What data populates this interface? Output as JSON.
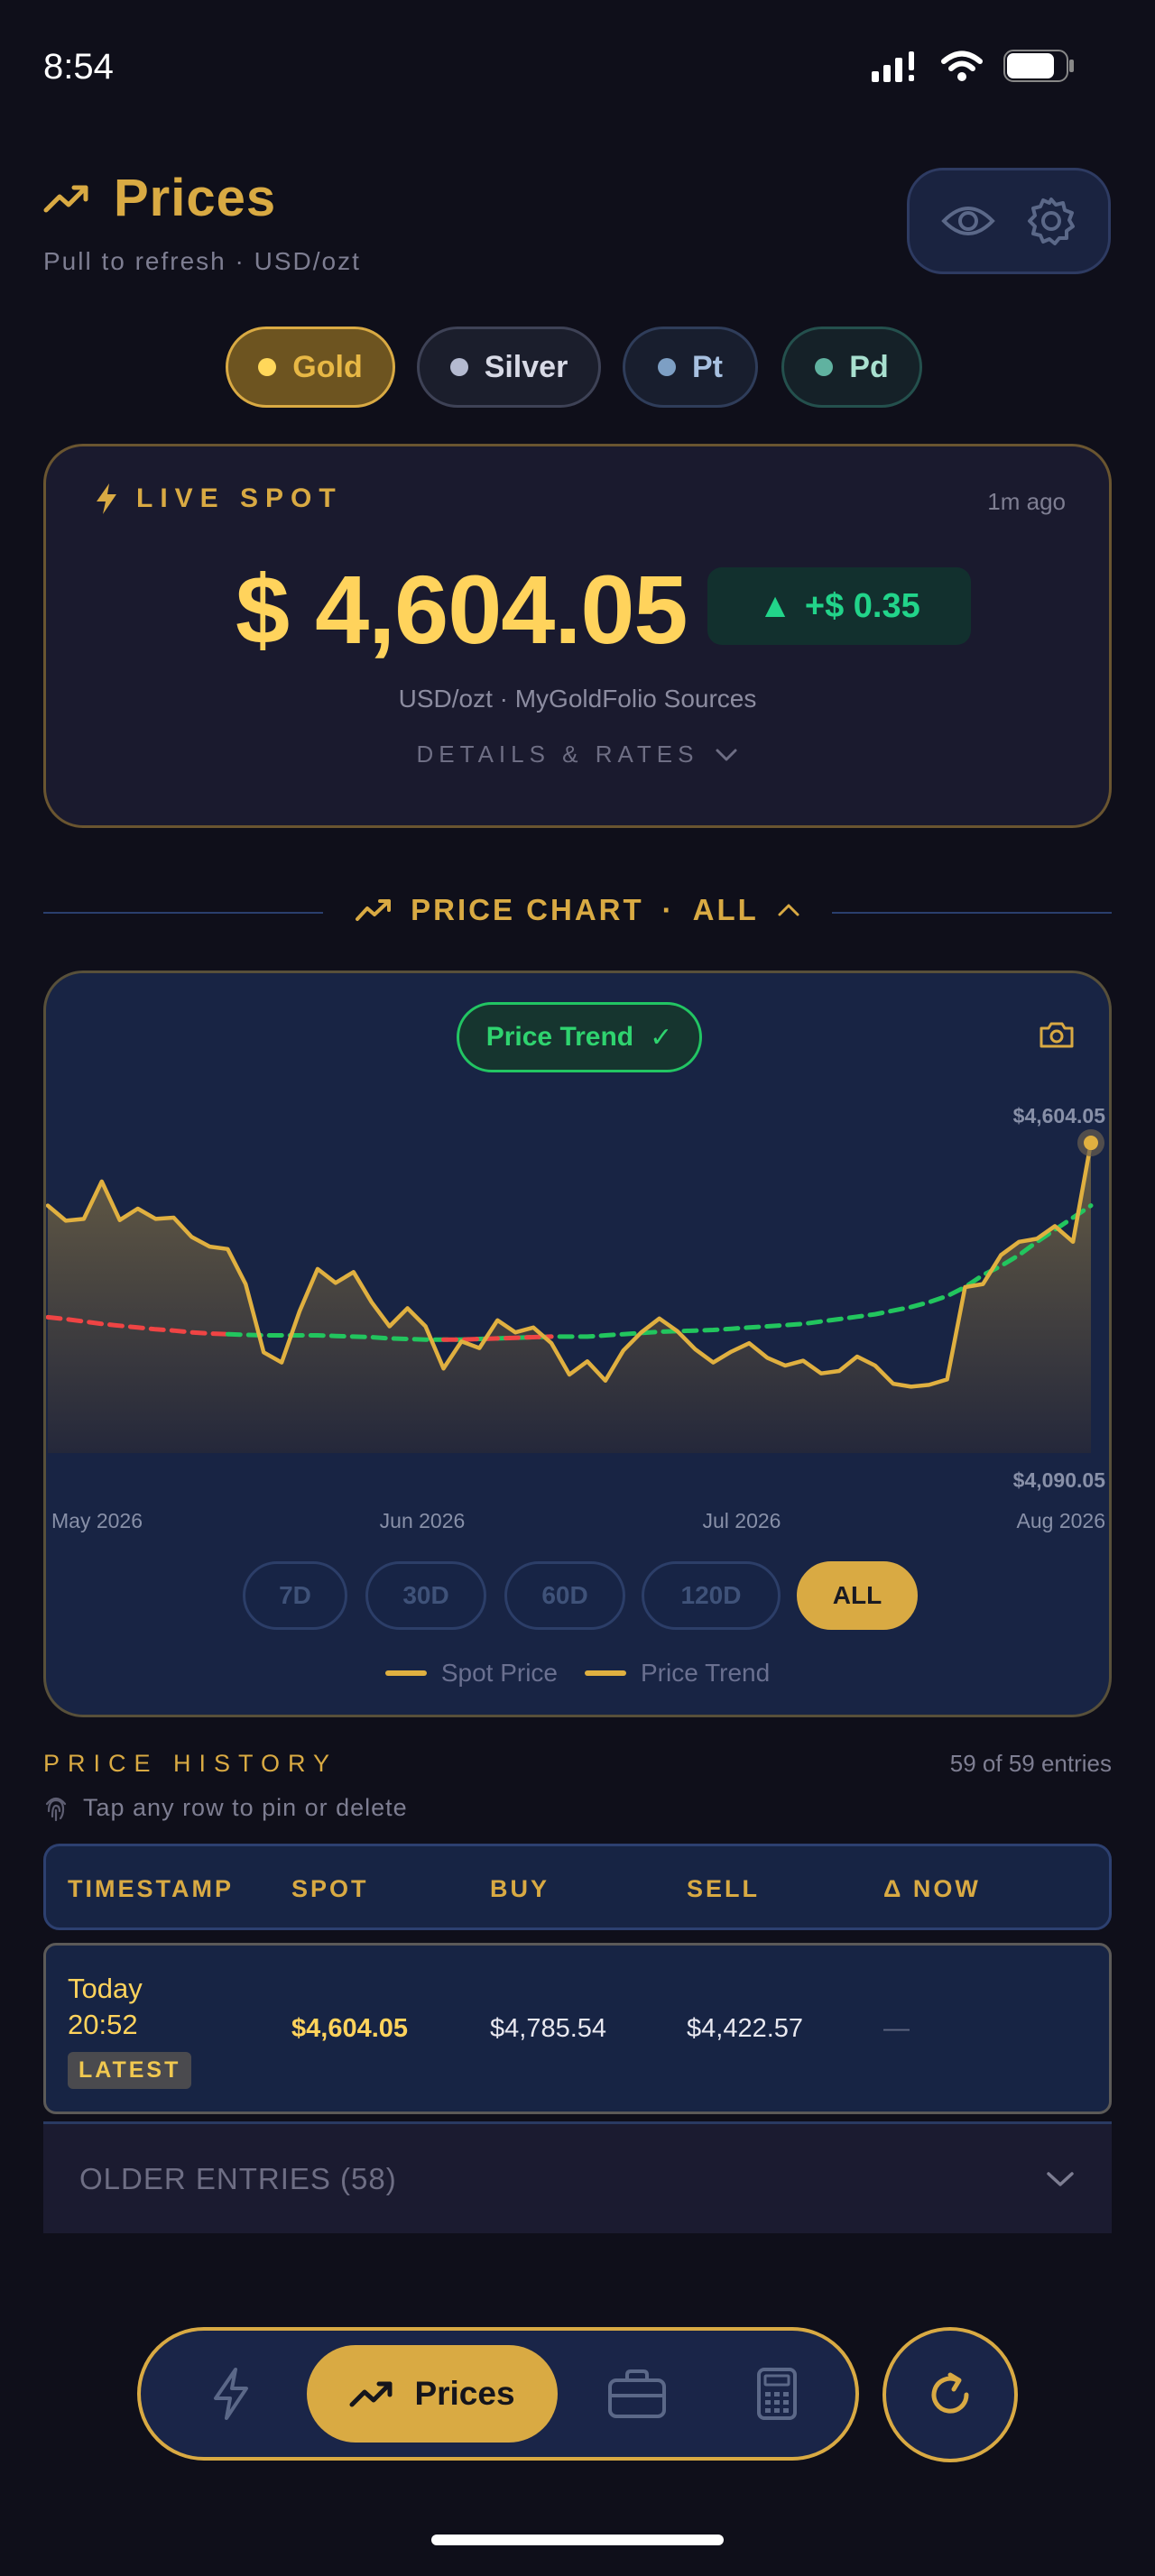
{
  "status_bar": {
    "time": "8:54"
  },
  "header": {
    "title": "Prices",
    "subtitle": "Pull to refresh  ·  USD/ozt",
    "icons": [
      "trending-up-icon",
      "eye-icon",
      "gear-icon"
    ]
  },
  "metals": [
    {
      "label": "Gold",
      "selected": true
    },
    {
      "label": "Silver",
      "selected": false
    },
    {
      "label": "Pt",
      "selected": false
    },
    {
      "label": "Pd",
      "selected": false
    }
  ],
  "spot": {
    "label": "LIVE SPOT",
    "updated": "1m ago",
    "price": "$ 4,604.05",
    "change": "+$ 0.35",
    "change_arrow": "▲",
    "source": "USD/ozt  ·  MyGoldFolio Sources",
    "details_label": "DETAILS & RATES"
  },
  "chart_section": {
    "title": "PRICE CHART",
    "range_label": "ALL",
    "separator": "·"
  },
  "chart_controls": {
    "trend_pill": "Price Trend",
    "trend_check": "✓",
    "ranges": [
      "7D",
      "30D",
      "60D",
      "120D",
      "ALL"
    ],
    "active_range": "ALL"
  },
  "chart_data": {
    "type": "line",
    "ylim": [
      4090.05,
      4604.05
    ],
    "y_labels": {
      "max": "$4,604.05",
      "min": "$4,090.05"
    },
    "x_tick_labels": [
      "May 2026",
      "Jun 2026",
      "Jul 2026",
      "Aug 2026"
    ],
    "legend": [
      "Spot Price",
      "Price Trend"
    ],
    "series": [
      {
        "name": "Spot Price",
        "values": [
          4500,
          4475,
          4478,
          4540,
          4476,
          4495,
          4478,
          4480,
          4448,
          4432,
          4428,
          4370,
          4257,
          4240,
          4325,
          4395,
          4372,
          4390,
          4340,
          4300,
          4330,
          4300,
          4230,
          4275,
          4264,
          4310,
          4290,
          4298,
          4272,
          4220,
          4242,
          4210,
          4260,
          4290,
          4313,
          4292,
          4262,
          4240,
          4258,
          4272,
          4248,
          4235,
          4243,
          4222,
          4226,
          4250,
          4235,
          4205,
          4200,
          4203,
          4212,
          4365,
          4370,
          4418,
          4440,
          4445,
          4466,
          4440,
          4604
        ]
      },
      {
        "name": "Price Trend",
        "values": [
          4315,
          4312,
          4308,
          4304,
          4301,
          4298,
          4295,
          4293,
          4290,
          4288,
          4287,
          4286,
          4285,
          4285,
          4285,
          4285,
          4284,
          4283,
          4282,
          4280,
          4279,
          4278,
          4278,
          4278,
          4279,
          4280,
          4281,
          4282,
          4283,
          4283,
          4283,
          4285,
          4287,
          4289,
          4291,
          4292,
          4293,
          4294,
          4296,
          4298,
          4300,
          4302,
          4304,
          4308,
          4312,
          4316,
          4320,
          4326,
          4332,
          4340,
          4350,
          4365,
          4385,
          4400,
          4418,
          4440,
          4460,
          4480,
          4500
        ]
      }
    ]
  },
  "history": {
    "title": "PRICE HISTORY",
    "count": "59 of 59 entries",
    "hint": "Tap any row to pin or delete",
    "columns": [
      "TIMESTAMP",
      "SPOT",
      "BUY",
      "SELL",
      "Δ NOW"
    ],
    "latest_row": {
      "day": "Today",
      "time": "20:52",
      "badge": "LATEST",
      "spot": "$4,604.05",
      "buy": "$4,785.54",
      "sell": "$4,422.57",
      "delta": "—"
    },
    "older_label": "OLDER ENTRIES (58)"
  },
  "nav": {
    "active_label": "Prices",
    "items": [
      "bolt-icon",
      "trending-up-icon",
      "briefcase-icon",
      "calculator-icon"
    ],
    "refresh_icon": "refresh-icon"
  },
  "colors": {
    "background": "#0f0f1a",
    "gold": "#d9aa43",
    "spot_line": "#e0b040",
    "trend_up": "#22c55e",
    "trend_down": "#ef4444",
    "positive": "#22d48a"
  }
}
